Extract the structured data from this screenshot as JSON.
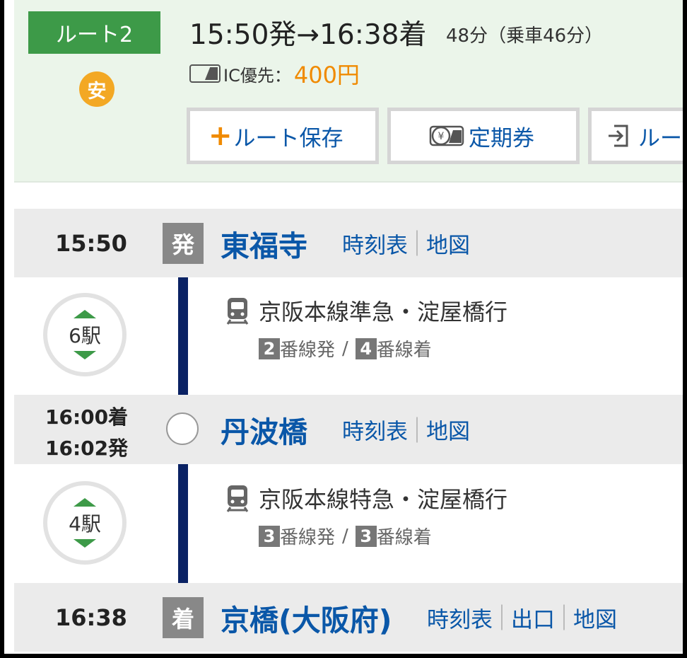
{
  "route": {
    "badge_label": "ルート2",
    "cheap_icon_label": "安",
    "time_range": "15:50発→16:38着",
    "duration": "48分（乗車46分）",
    "ic_label": "IC優先：",
    "fare": "400円"
  },
  "actions": {
    "save_label": "ルート保存",
    "pass_label": "定期券",
    "share_label": "ルー"
  },
  "stations": [
    {
      "time": "15:50",
      "badge": "発",
      "name": "東福寺",
      "links": [
        "時刻表",
        "地図"
      ]
    },
    {
      "arrive": "16:00着",
      "depart": "16:02発",
      "name": "丹波橋",
      "links": [
        "時刻表",
        "地図"
      ]
    },
    {
      "time": "16:38",
      "badge": "着",
      "name": "京橋(大阪府)",
      "links": [
        "時刻表",
        "出口",
        "地図"
      ]
    }
  ],
  "segments": [
    {
      "stops": "6駅",
      "train": "京阪本線準急・淀屋橋行",
      "dep_platform": "2",
      "dep_suffix": "番線発",
      "arr_platform": "4",
      "arr_suffix": "番線着"
    },
    {
      "stops": "4駅",
      "train": "京阪本線特急・淀屋橋行",
      "dep_platform": "3",
      "dep_suffix": "番線発",
      "arr_platform": "3",
      "arr_suffix": "番線着"
    }
  ],
  "colors": {
    "header_bg": "#ebf5ea",
    "route_badge": "#3d9a48",
    "cheap_icon": "#f3a824",
    "fare": "#f08a00",
    "link": "#0a57a8",
    "rail_line": "#0a2264"
  }
}
